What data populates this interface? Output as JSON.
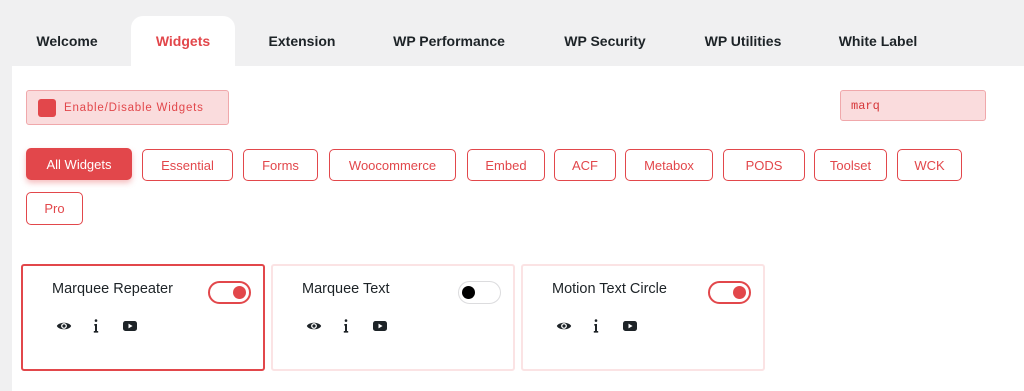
{
  "tabs": [
    {
      "label": "Welcome",
      "active": false
    },
    {
      "label": "Widgets",
      "active": true
    },
    {
      "label": "Extension",
      "active": false
    },
    {
      "label": "WP Performance",
      "active": false
    },
    {
      "label": "WP Security",
      "active": false
    },
    {
      "label": "WP Utilities",
      "active": false
    },
    {
      "label": "White Label",
      "active": false
    }
  ],
  "toolbar": {
    "enable_label": "Enable/Disable Widgets",
    "search_value": "marq"
  },
  "filters": [
    {
      "label": "All Widgets",
      "active": true
    },
    {
      "label": "Essential"
    },
    {
      "label": "Forms"
    },
    {
      "label": "Woocommerce"
    },
    {
      "label": "Embed"
    },
    {
      "label": "ACF"
    },
    {
      "label": "Metabox"
    },
    {
      "label": "PODS"
    },
    {
      "label": "Toolset"
    },
    {
      "label": "WCK"
    },
    {
      "label": "Pro"
    }
  ],
  "widgets": [
    {
      "title": "Marquee Repeater",
      "enabled": true,
      "icons": [
        "eye-icon",
        "info-icon",
        "video-icon"
      ]
    },
    {
      "title": "Marquee Text",
      "enabled": false,
      "icons": [
        "eye-icon",
        "info-icon",
        "video-icon"
      ]
    },
    {
      "title": "Motion Text Circle",
      "enabled": true,
      "icons": [
        "eye-icon",
        "info-icon",
        "video-icon"
      ]
    }
  ],
  "colors": {
    "accent": "#e2474b",
    "accent_light": "#fadcdd",
    "background": "#f0f0f1"
  }
}
